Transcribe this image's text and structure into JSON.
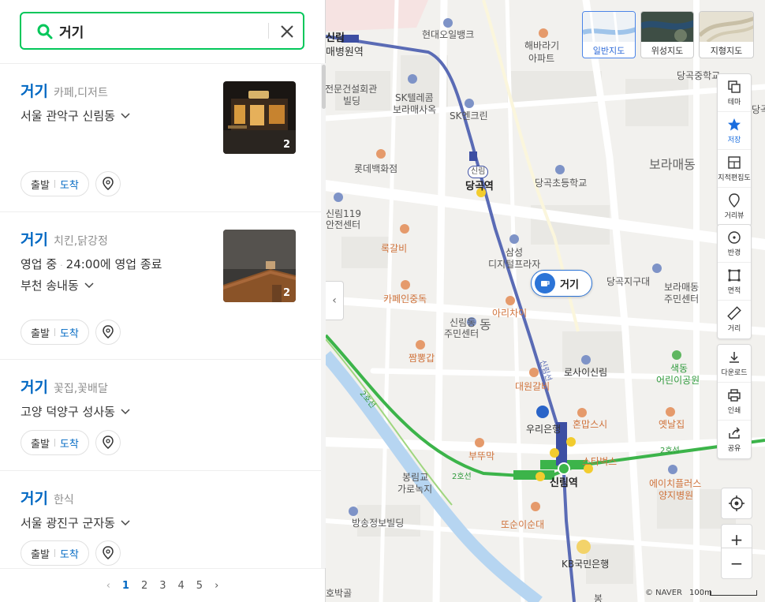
{
  "search": {
    "query": "거기",
    "clear_label": "×"
  },
  "results": [
    {
      "name": "거기",
      "category": "카페,디저트",
      "address": "서울 관악구 신림동",
      "status": "",
      "hours": "",
      "photo_count": "2",
      "depart": "출발",
      "arrive": "도착"
    },
    {
      "name": "거기",
      "category": "치킨,닭강정",
      "address": "부천 송내동",
      "status": "영업 중",
      "hours": "24:00에 영업 종료",
      "photo_count": "2",
      "depart": "출발",
      "arrive": "도착"
    },
    {
      "name": "거기",
      "category": "꽃집,꽃배달",
      "address": "고양 덕양구 성사동",
      "status": "",
      "hours": "",
      "photo_count": "",
      "depart": "출발",
      "arrive": "도착"
    },
    {
      "name": "거기",
      "category": "한식",
      "address": "서울 광진구 군자동",
      "status": "",
      "hours": "",
      "photo_count": "",
      "depart": "출발",
      "arrive": "도착"
    }
  ],
  "pagination": {
    "pages": [
      "1",
      "2",
      "3",
      "4",
      "5"
    ],
    "current": "1"
  },
  "map": {
    "types": [
      "일반지도",
      "위성지도",
      "지형지도"
    ],
    "selected_type": "일반지도",
    "tools": [
      "테마",
      "저장",
      "지적편집도",
      "거리뷰",
      "반경",
      "면적",
      "거리",
      "다운로드",
      "인쇄",
      "공유"
    ],
    "zoom_in": "+",
    "zoom_out": "−",
    "marker_label": "거기",
    "copyright": "© NAVER",
    "scale_text": "100m",
    "labels": {
      "sillim_top": "신림",
      "maebyeongwon": "매병원역",
      "hyundai_oil": "현대오일뱅크",
      "haebaragi": "해바라기",
      "apt": "아파트",
      "danggok_middle": "당곡중학교",
      "danggok_right": "당곡",
      "jeonmun1": "전문건설회관",
      "jeonmun2": "빌딩",
      "sk1": "SK텔레콤",
      "sk2": "보라매사옥",
      "sk_enclean": "SK엔크린",
      "lotte": "롯데백화점",
      "sillim_mini": "신림",
      "danggok_station": "당곡역",
      "danggok_elem": "당곡초등학교",
      "boramae_dong": "보라매동",
      "sillim119_1": "신림119",
      "sillim119_2": "안전센터",
      "rokgalbi": "록갈비",
      "samsung1": "삼성",
      "samsung2": "디지털프라자",
      "danggok_jigudae": "당곡지구대",
      "boramae_center1": "보라매동",
      "boramae_center2": "주민센터",
      "cafe_injoongdok": "카페인중독",
      "arichai": "아리차이",
      "sillim_center1": "신림동",
      "sillim_center2": "주민센터",
      "dong": "동",
      "jjambbong": "짬뽕갑",
      "rosaisillim": "로사이신림",
      "saekdong1": "색동",
      "saekdong2": "어린이공원",
      "daewon": "대원갈비",
      "line2_a": "2호선",
      "woori": "우리은행",
      "honmap": "혼맙스시",
      "yetnal": "옛날집",
      "boomdduk": "부뚜막",
      "starbucks": "스타벅스",
      "line2_b": "2호선",
      "line2_c": "2호선",
      "line2_d": "2호선",
      "sillim_station": "신림역",
      "aichplus1": "에이치플러스",
      "aichplus2": "양지병원",
      "boramgyo1": "봉림교",
      "boramgyo2": "가로녹지",
      "broadcast": "방송정보빌딩",
      "ttosun": "또순이순대",
      "kb": "KB국민은행",
      "hobakgol": "호박골",
      "bong": "봉",
      "sillim_line": "신림선"
    }
  }
}
